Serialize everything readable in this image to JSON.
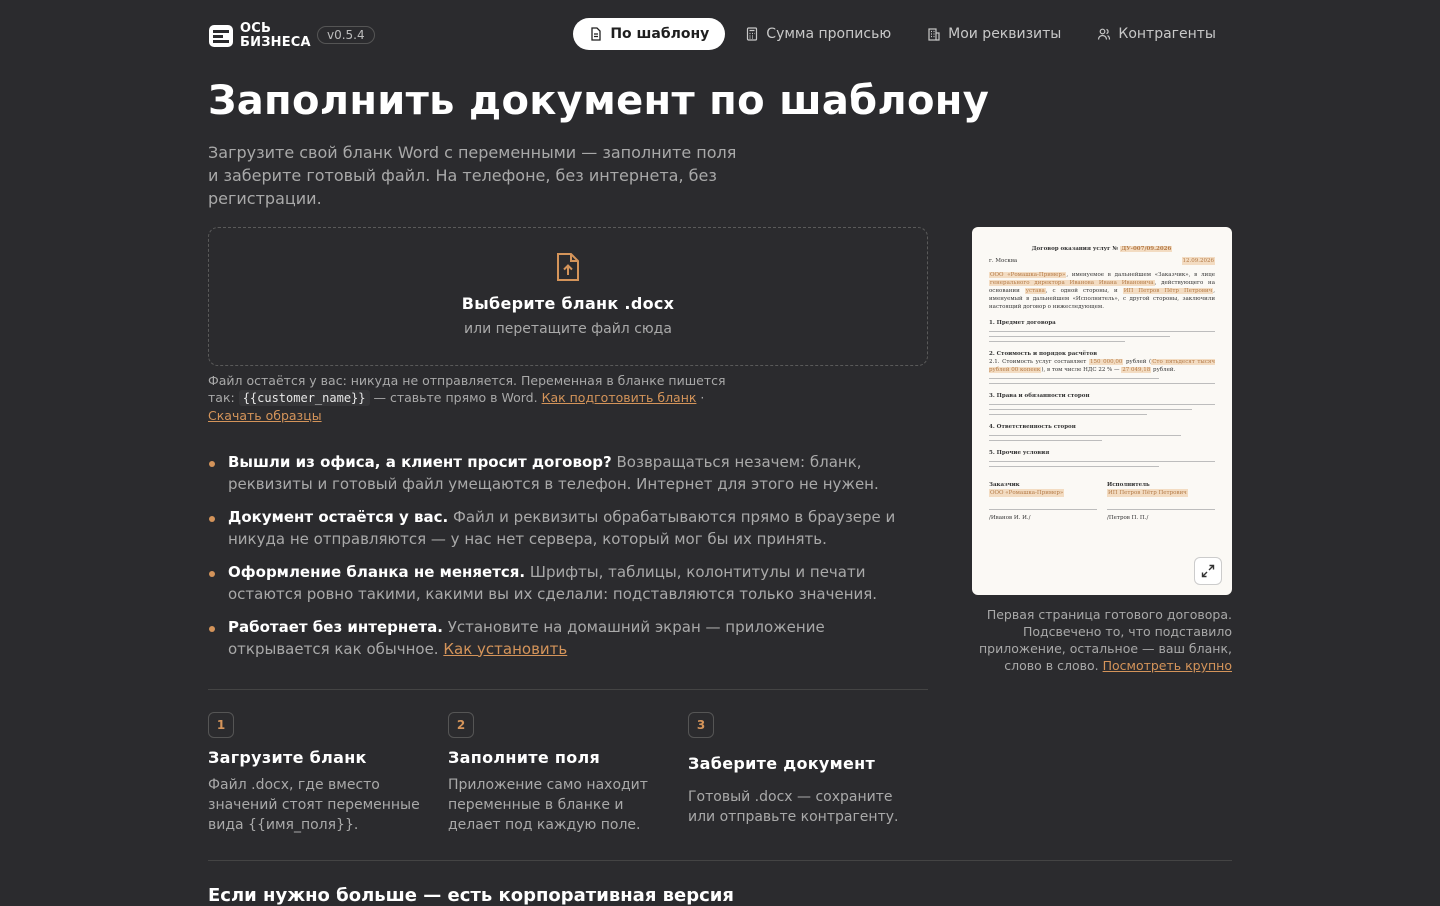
{
  "brand": {
    "line1": "ОСЬ",
    "line2": "БИЗНЕСА",
    "version": "v0.5.4"
  },
  "nav": [
    {
      "label": "По шаблону",
      "active": true
    },
    {
      "label": "Сумма прописью"
    },
    {
      "label": "Мои реквизиты"
    },
    {
      "label": "Контрагенты"
    }
  ],
  "hero": {
    "title": "Заполнить документ по шаблону",
    "lead": "Загрузите свой бланк Word с переменными — заполните поля и заберите готовый файл. На телефоне, без интернета, без регистрации."
  },
  "upload": {
    "title": "Выберите бланк .docx",
    "subtitle": "или перетащите файл сюда"
  },
  "note": {
    "text1": "Файл остаётся у вас: никуда не отправляется. Переменная в бланке пишется так:",
    "code": "{{customer_name}}",
    "text2": "— ставьте прямо в Word.",
    "link1": "Как подготовить бланк",
    "link2": "Скачать образцы"
  },
  "bullets": [
    {
      "bold": "Вышли из офиса, а клиент просит договор?",
      "text": "Возвращаться незачем: бланк, реквизиты и готовый файл умещаются в телефон. Интернет для этого не нужен."
    },
    {
      "bold": "Документ остаётся у вас.",
      "text": "Файл и реквизиты обрабатываются прямо в браузере и никуда не отправляются — у нас нет сервера, который мог бы их принять."
    },
    {
      "bold": "Оформление бланка не меняется.",
      "text": "Шрифты, таблицы, колонтитулы и печати остаются ровно такими, какими вы их сделали: подставляются только значения."
    },
    {
      "bold": "Работает без интернета.",
      "text": "Установите на домашний экран — приложение открывается как обычное.",
      "link": "Как установить"
    }
  ],
  "steps": [
    {
      "num": "1",
      "title": "Загрузите бланк",
      "desc": "Файл .docx, где вместо значений стоят переменные вида {{имя_поля}}."
    },
    {
      "num": "2",
      "title": "Заполните поля",
      "desc": "Приложение само находит переменные в бланке и делает под каждую поле."
    },
    {
      "num": "3",
      "title": "Заберите документ",
      "desc": "Готовый .docx — сохраните или отправьте контрагенту."
    }
  ],
  "bottom_title": "Если нужно больше — есть корпоративная версия",
  "preview": {
    "doc_title": "Договор оказания услуг №",
    "doc_number": "ДУ-007/09.2026",
    "city": "г. Москва",
    "date": "12.09.2026",
    "party1": "ООО «Ромашка-Пример»",
    "intro_a": ", именуемое в дальнейшем «Заказчик», в лице",
    "director": "генерального директора Иванова Ивана Ивановича",
    "intro_b": ", действующего на основании",
    "basis": "устава",
    "intro_c": ", с одной стороны, и",
    "party2": "ИП Петров Пётр Петрович",
    "intro_d": ", именуемый в дальнейшем «Исполнитель», с другой стороны, заключили настоящий договор о нижеследующем.",
    "sec1": "1. Предмет договора",
    "sec2": "2. Стоимость и порядок расчётов",
    "cost_a": "2.1. Стоимость услуг составляет",
    "cost_sum": "150 000,00",
    "cost_b": "рублей (",
    "cost_words": "Сто пятьдесят тысяч рублей 00 копеек",
    "cost_c": "), в том числе НДС 22 % —",
    "vat": "27 049,18",
    "cost_d": "рублей.",
    "sec3": "3. Права и обязанности сторон",
    "sec4": "4. Ответственность сторон",
    "sec5": "5. Прочие условия",
    "client_label": "Заказчик",
    "client_name": "ООО «Ромашка-Пример»",
    "client_sign": "/Иванов И. И./",
    "contractor_label": "Исполнитель",
    "contractor_name": "ИП Петров Пётр Петрович",
    "contractor_sign": "/Петров П. П./",
    "caption": "Первая страница готового договора. Подсвечено то, что подставило приложение, остальное — ваш бланк, слово в слово.",
    "caption_link": "Посмотреть крупно"
  },
  "colors": {
    "bg": "#2b2b2e",
    "accent": "#d4945a",
    "text": "#e6e6e6",
    "muted": "#a9a9a9"
  }
}
